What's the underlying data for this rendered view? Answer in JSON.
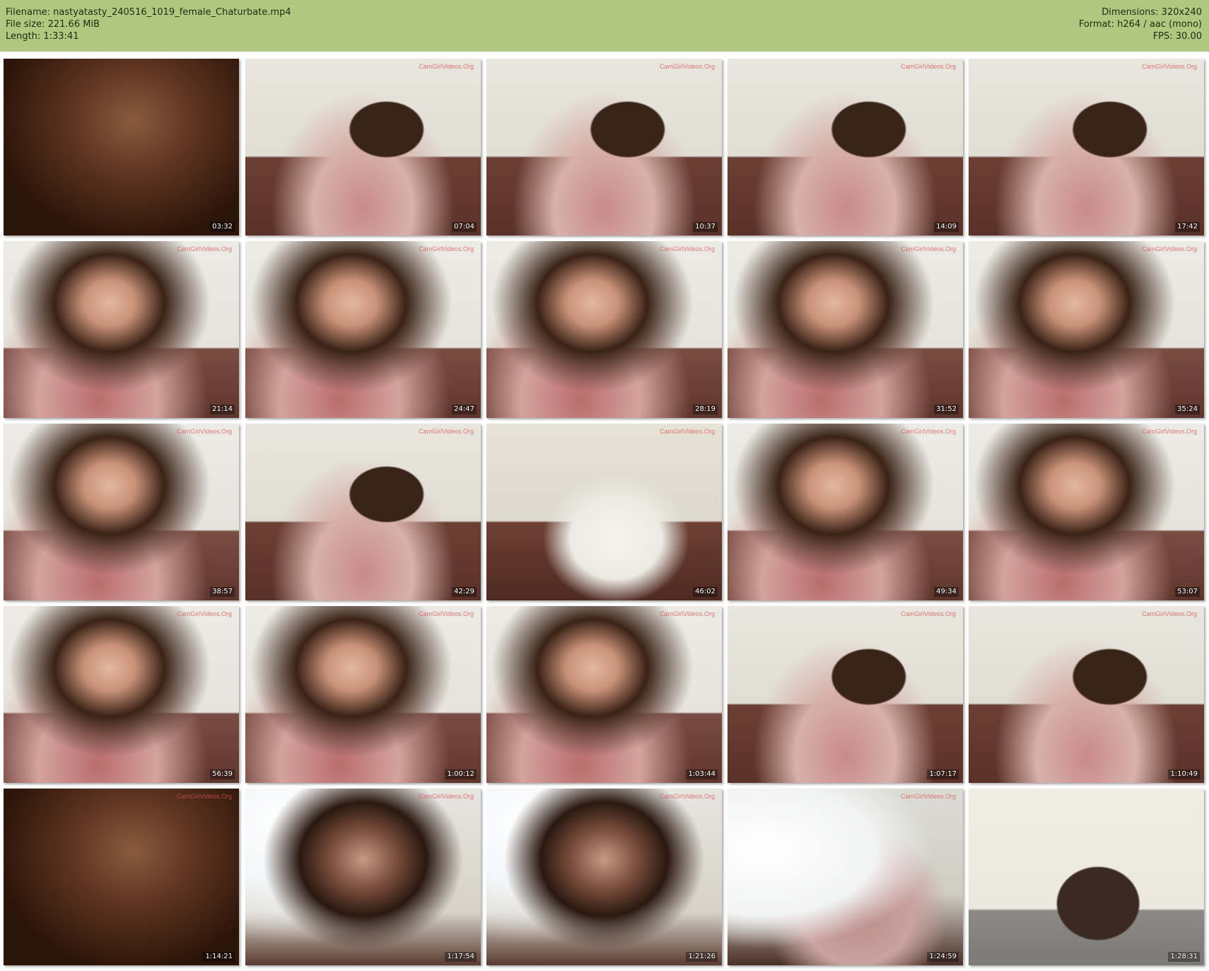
{
  "header": {
    "filename": "Filename: nastyatasty_240516_1019_female_Chaturbate.mp4",
    "filesize": "File size: 221.66 MiB",
    "length": "Length: 1:33:41",
    "dimensions": "Dimensions: 320x240",
    "format": "Format: h264 / aac (mono)",
    "fps": "FPS: 30.00"
  },
  "colors": {
    "header_bg": "#aec97f"
  },
  "watermark": "CamGirlVideos.Org",
  "thumbnails": [
    {
      "time": "03:32",
      "scene": "dark-window"
    },
    {
      "time": "07:04",
      "scene": "couch-floral"
    },
    {
      "time": "10:37",
      "scene": "couch-floral"
    },
    {
      "time": "14:09",
      "scene": "couch-floral"
    },
    {
      "time": "17:42",
      "scene": "couch-floral"
    },
    {
      "time": "21:14",
      "scene": "closeup"
    },
    {
      "time": "24:47",
      "scene": "closeup"
    },
    {
      "time": "28:19",
      "scene": "closeup"
    },
    {
      "time": "31:52",
      "scene": "closeup"
    },
    {
      "time": "35:24",
      "scene": "closeup"
    },
    {
      "time": "38:57",
      "scene": "closeup"
    },
    {
      "time": "42:29",
      "scene": "couch-floral"
    },
    {
      "time": "46:02",
      "scene": "empty-couch"
    },
    {
      "time": "49:34",
      "scene": "closeup"
    },
    {
      "time": "53:07",
      "scene": "closeup"
    },
    {
      "time": "56:39",
      "scene": "closeup"
    },
    {
      "time": "1:00:12",
      "scene": "closeup"
    },
    {
      "time": "1:03:44",
      "scene": "closeup"
    },
    {
      "time": "1:07:17",
      "scene": "couch-floral"
    },
    {
      "time": "1:10:49",
      "scene": "couch-floral"
    },
    {
      "time": "1:14:21",
      "scene": "dark-window"
    },
    {
      "time": "1:17:54",
      "scene": "bright-closeup"
    },
    {
      "time": "1:21:26",
      "scene": "bright-closeup"
    },
    {
      "time": "1:24:59",
      "scene": "bright-window"
    },
    {
      "time": "1:28:31",
      "scene": "empty-room"
    }
  ]
}
